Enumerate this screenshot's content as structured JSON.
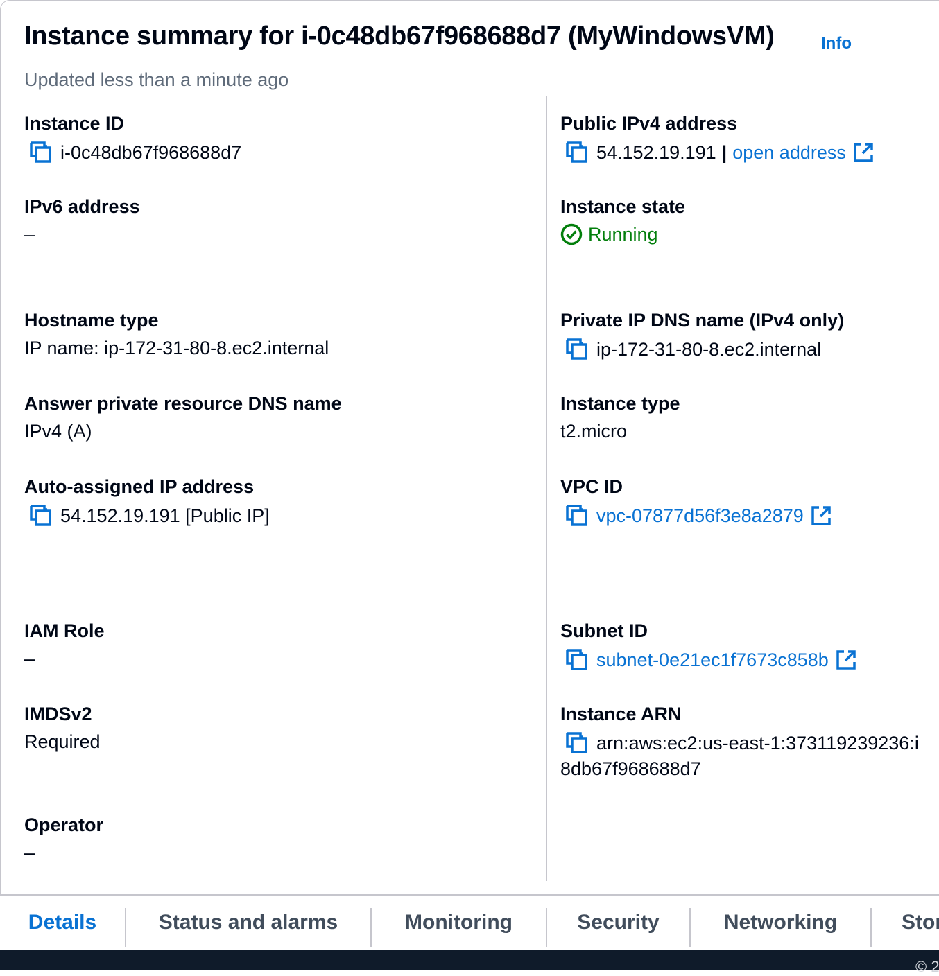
{
  "header": {
    "title": "Instance summary for i-0c48db67f968688d7 (MyWindowsVM)",
    "info_link": "Info",
    "updated": "Updated less than a minute ago"
  },
  "left": {
    "instance_id": {
      "label": "Instance ID",
      "value": "i-0c48db67f968688d7"
    },
    "ipv6": {
      "label": "IPv6 address",
      "value": "–"
    },
    "hostname_type": {
      "label": "Hostname type",
      "value": "IP name: ip-172-31-80-8.ec2.internal"
    },
    "answer_dns": {
      "label": "Answer private resource DNS name",
      "value": "IPv4 (A)"
    },
    "auto_ip": {
      "label": "Auto-assigned IP address",
      "value": "54.152.19.191 [Public IP]"
    },
    "iam_role": {
      "label": "IAM Role",
      "value": "–"
    },
    "imdsv2": {
      "label": "IMDSv2",
      "value": "Required"
    },
    "operator": {
      "label": "Operator",
      "value": "–"
    }
  },
  "right": {
    "public_ipv4": {
      "label": "Public IPv4 address",
      "value": "54.152.19.191",
      "separator": "|",
      "link": "open address"
    },
    "state": {
      "label": "Instance state",
      "value": "Running"
    },
    "private_dns": {
      "label": "Private IP DNS name (IPv4 only)",
      "value": "ip-172-31-80-8.ec2.internal"
    },
    "instance_type": {
      "label": "Instance type",
      "value": "t2.micro"
    },
    "vpc_id": {
      "label": "VPC ID",
      "value": "vpc-07877d56f3e8a2879"
    },
    "subnet_id": {
      "label": "Subnet ID",
      "value": "subnet-0e21ec1f7673c858b"
    },
    "arn": {
      "label": "Instance ARN",
      "value_line1": "arn:aws:ec2:us-east-1:373119239236:i",
      "value_line2": "8db67f968688d7"
    }
  },
  "tabs": [
    {
      "label": "Details",
      "active": true
    },
    {
      "label": "Status and alarms",
      "active": false
    },
    {
      "label": "Monitoring",
      "active": false
    },
    {
      "label": "Security",
      "active": false
    },
    {
      "label": "Networking",
      "active": false
    },
    {
      "label": "Stor",
      "active": false
    }
  ],
  "footer": {
    "text": "© 2"
  },
  "colors": {
    "link": "#0972d3",
    "running": "#037f0c",
    "text": "#000716",
    "muted": "#5f6b7a",
    "footer": "#0f1b2a"
  },
  "icons": {
    "copy": "copy-icon",
    "external": "external-link-icon",
    "status": "status-success-icon"
  }
}
